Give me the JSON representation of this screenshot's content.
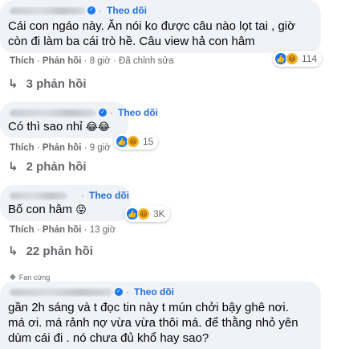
{
  "comments": [
    {
      "follow": "Theo dõi",
      "text_lines": [
        "Cái con ngáo này. Ăn nói ko được câu nào lọt tai , giờ",
        "còn đi làm ba cái trò hề. Câu view hả con hâm"
      ],
      "actions": {
        "like": "Thích",
        "reply": "Phản hồi",
        "time": "8 giờ",
        "edited": "Đã chỉnh sửa"
      },
      "reaction_count": "114",
      "replies": "3 phản hồi"
    },
    {
      "follow": "Theo dõi",
      "text_lines": [
        "Có thì sao nhỉ"
      ],
      "actions": {
        "like": "Thích",
        "reply": "Phản hồi",
        "time": "9 giờ"
      },
      "reaction_count": "15",
      "replies": "2 phản hồi"
    },
    {
      "follow": "Theo dõi",
      "text_lines": [
        "Bố con hâm"
      ],
      "actions": {
        "like": "Thích",
        "reply": "Phản hồi",
        "time": "13 giờ"
      },
      "reaction_count": "3K",
      "replies": "22 phản hồi"
    },
    {
      "badge": "Fan cứng",
      "follow": "Theo dõi",
      "text_lines": [
        "gần 2h sáng và t đọc tin này t mún chởi bậy ghê nơi.",
        "má ơi. má rảnh nợ vừa vừa thôi má. để thằng nhỏ yên",
        "dùm cái đi . nó chưa đủ khổ hay sao?"
      ]
    }
  ],
  "colors": {
    "bubble": "#f0f2f5",
    "link": "#216fdb",
    "muted": "#65676b"
  },
  "icons": {
    "like": "like-icon",
    "haha": "haha-icon",
    "reply_arrow": "reply-arrow-icon",
    "fan_badge": "diamond-icon"
  }
}
